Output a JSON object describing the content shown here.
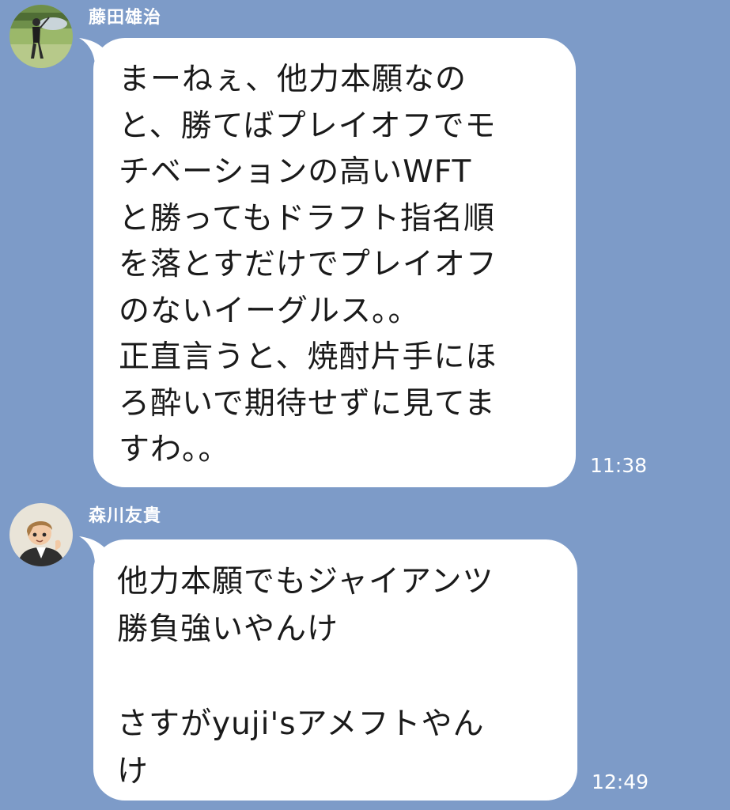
{
  "messages": [
    {
      "sender": "藤田雄治",
      "avatar_icon": "golfer-avatar-icon",
      "text": "まーねぇ、他力本願なの\nと、勝てばプレイオフでモ\nチベーションの高いWFT\nと勝ってもドラフト指名順\nを落とすだけでプレイオフ\nのないイーグルス。。\n正直言うと、焼酎片手にほ\nろ酔いで期待せずに見てま\nすわ。。",
      "time": "11:38"
    },
    {
      "sender": "森川友貴",
      "avatar_icon": "illustrated-person-avatar-icon",
      "text": "他力本願でもジャイアンツ\n勝負強いやんけ\n\nさすがyuji'sアメフトやん\nけ",
      "time": "12:49"
    }
  ],
  "colors": {
    "background": "#7d9bc8",
    "bubble": "#ffffff",
    "text": "#1a1a1a",
    "meta_text": "#ffffff"
  }
}
